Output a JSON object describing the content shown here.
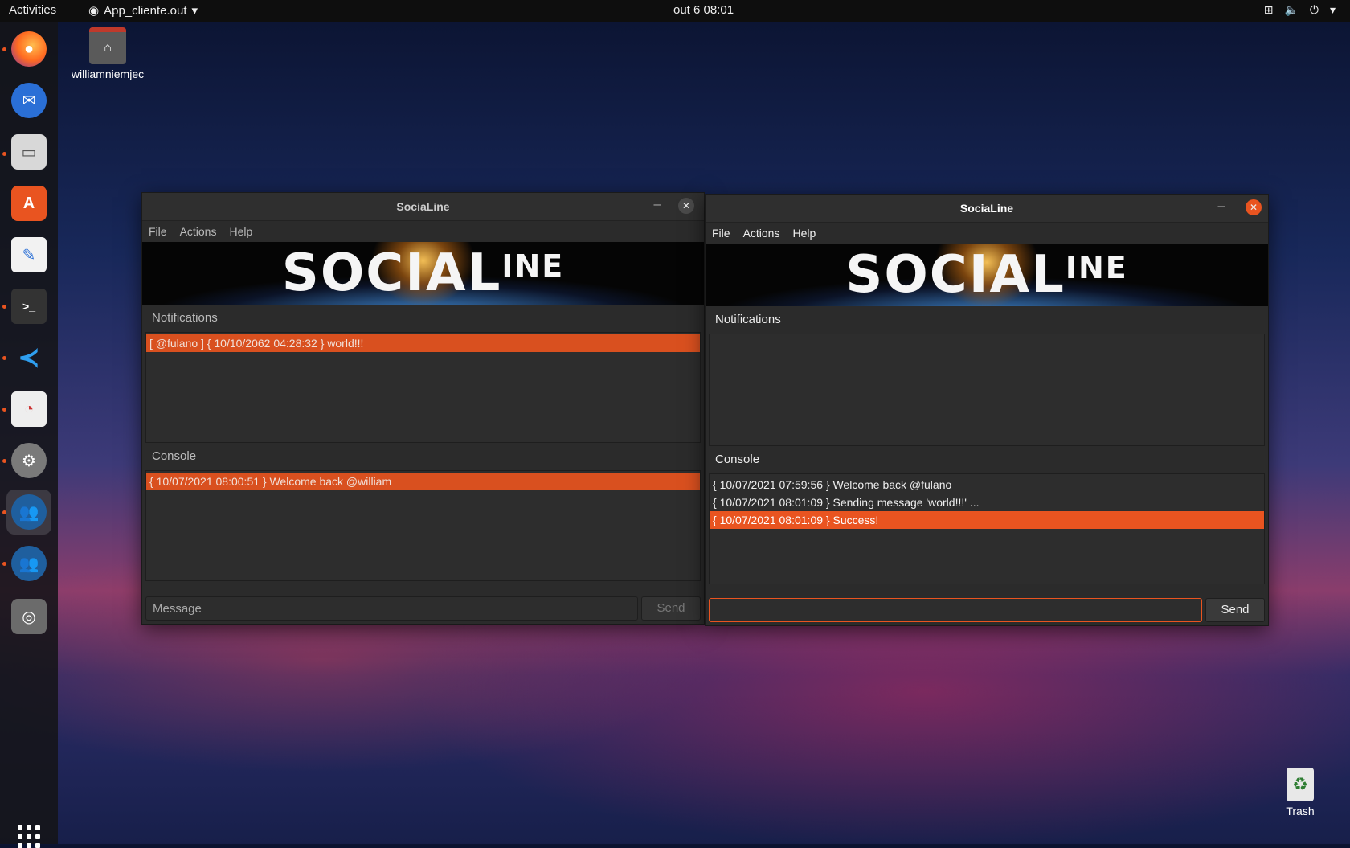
{
  "topbar": {
    "activities": "Activities",
    "app_name": "App_cliente.out",
    "clock": "out 6  08:01"
  },
  "desktop": {
    "home_label": "williamniemjec",
    "trash_label": "Trash"
  },
  "dock": [
    "firefox-icon",
    "thunderbird-icon",
    "files-icon",
    "software-icon",
    "text-editor-icon",
    "terminal-icon",
    "vscode-icon",
    "document-viewer-icon",
    "settings-icon",
    "socialine-icon",
    "socialine-icon-2",
    "disc-icon"
  ],
  "window_left": {
    "title": "SociaLine",
    "menu": [
      "File",
      "Actions",
      "Help"
    ],
    "banner_main": "SOCIAL",
    "banner_small": "INE",
    "notifications_label": "Notifications",
    "notifications": [
      "[ @fulano ]  { 10/10/2062 04:28:32 } world!!!"
    ],
    "console_label": "Console",
    "console": [
      "{ 10/07/2021 08:00:51 } Welcome back @william"
    ],
    "message_placeholder": "Message",
    "send_label": "Send"
  },
  "window_right": {
    "title": "SociaLine",
    "menu": [
      "File",
      "Actions",
      "Help"
    ],
    "banner_main": "SOCIAL",
    "banner_small": "INE",
    "notifications_label": "Notifications",
    "notifications": [],
    "console_label": "Console",
    "console": [
      "{ 10/07/2021 07:59:56 } Welcome back @fulano",
      "{ 10/07/2021 08:01:09 } Sending message 'world!!!' ...",
      "{ 10/07/2021 08:01:09 } Success!"
    ],
    "message_value": "",
    "send_label": "Send"
  },
  "colors": {
    "accent": "#e95420"
  }
}
